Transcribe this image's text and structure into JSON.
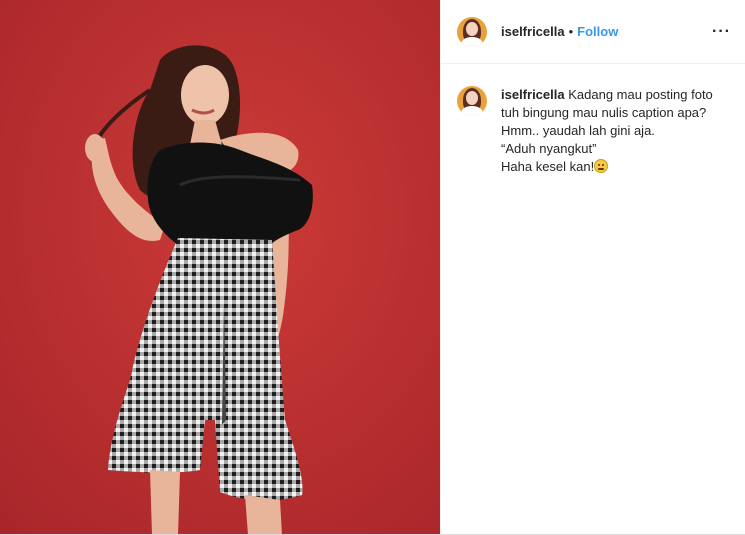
{
  "header": {
    "username": "iselfricella",
    "separator": "•",
    "follow_label": "Follow",
    "more_label": "···"
  },
  "caption": {
    "username": "iselfricella",
    "lines": [
      "Kadang mau posting foto",
      "tuh bingung mau nulis caption apa?",
      "Hmm.. yaudah lah gini aja.",
      "“Aduh nyangkut”",
      "Haha kesel kan!"
    ]
  },
  "icons": {
    "more": "more-options-icon",
    "emoji": "grimacing-face-emoji-icon"
  },
  "colors": {
    "photo_background": "#c0302e",
    "follow": "#3897f0",
    "avatar_ring": "#e9a23b"
  }
}
